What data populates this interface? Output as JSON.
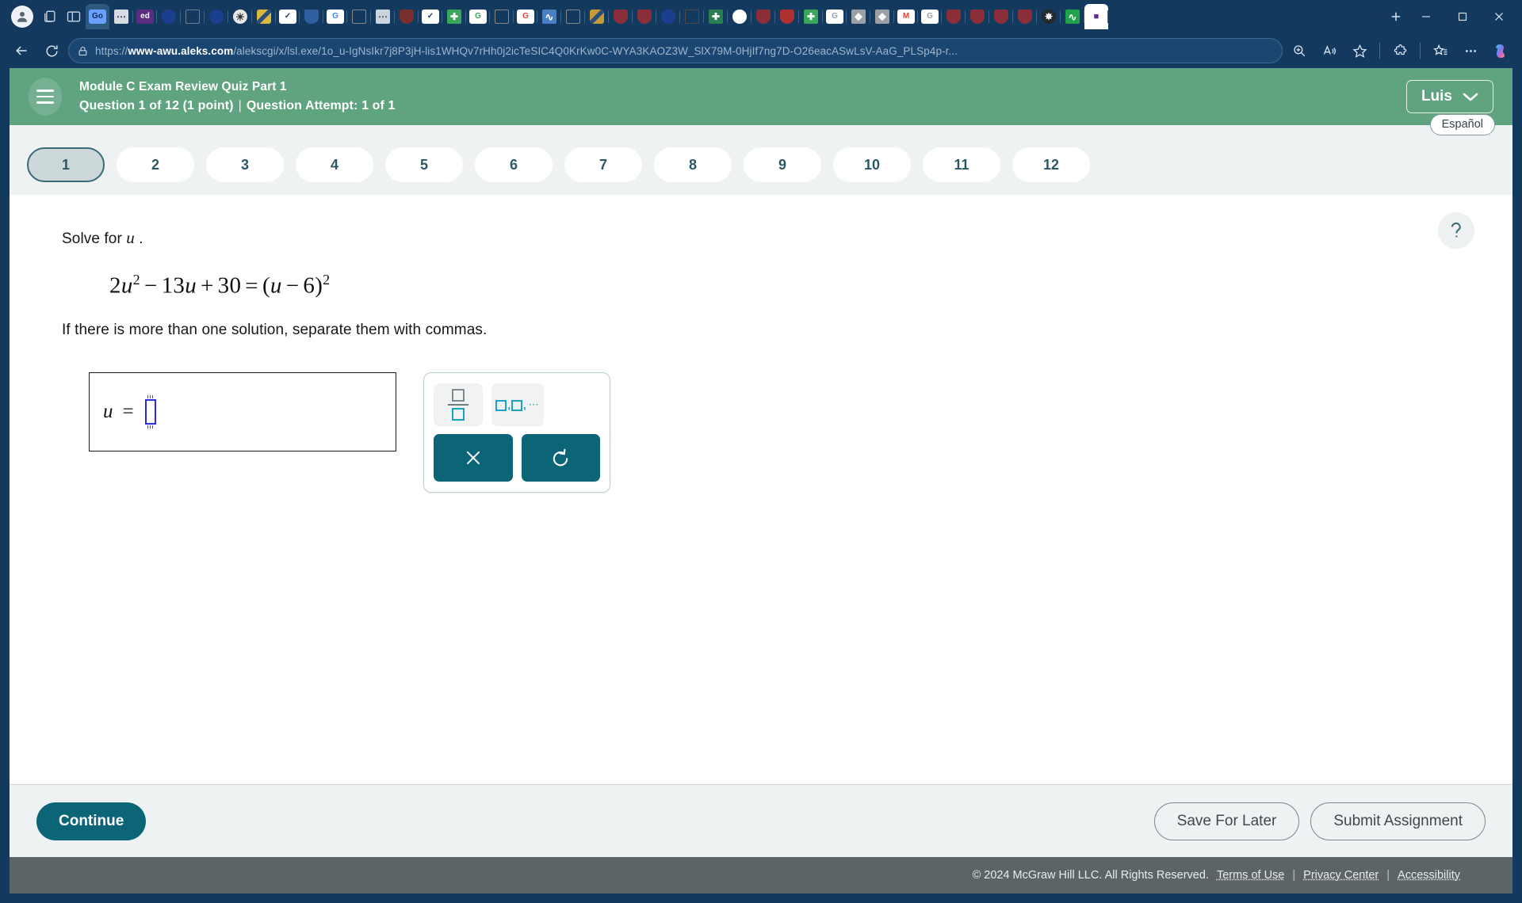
{
  "browser": {
    "url_prefix": "https://",
    "url_domain": "www-awu.aleks.com",
    "url_path": "/alekscgi/x/lsl.exe/1o_u-IgNsIkr7j8P3jH-lis1WHQv7rHh0j2icTeSIC4Q0KrKw0C-WYA3KAOZ3W_SlX79M-0HjIf7ng7D-O26eacASwLsV-AaG_PLSp4p-r...",
    "icons": {
      "profile": "profile-avatar-icon",
      "collections": "collections-icon",
      "split_screen": "split-screen-icon",
      "back": "back-arrow-icon",
      "reload": "reload-icon",
      "lock": "site-lock-icon",
      "zoom": "zoom-icon",
      "read_aloud": "read-aloud-icon",
      "favorite": "favorite-star-icon",
      "extensions": "extensions-puzzle-icon",
      "favorites_bar": "favorites-list-icon",
      "settings_more": "more-options-icon",
      "copilot": "copilot-icon",
      "new_tab": "new-tab-plus-icon",
      "minimize": "minimize-icon",
      "maximize": "maximize-icon",
      "close": "close-window-icon"
    },
    "tabs": [
      {
        "label": "Go",
        "bg": "#6aa0ff",
        "fg": "#0d2b55",
        "kind": "text",
        "state": "active"
      },
      {
        "label": "",
        "bg": "#d8dde3",
        "fg": "#444",
        "kind": "folder",
        "state": "normal"
      },
      {
        "label": "ed",
        "bg": "#5b2d82",
        "fg": "#ffffff",
        "kind": "text",
        "state": "normal"
      },
      {
        "label": "",
        "bg": "#1b3f8f",
        "fg": "#ffffff",
        "kind": "circle",
        "state": "normal"
      },
      {
        "label": "",
        "bg": "#ffffff",
        "fg": "#6b7d8f",
        "kind": "doc",
        "state": "normal"
      },
      {
        "label": "",
        "bg": "#1b3f8f",
        "fg": "#ffffff",
        "kind": "circle",
        "state": "normal"
      },
      {
        "label": "",
        "bg": "#e8e8e8",
        "fg": "#333",
        "kind": "sun",
        "state": "normal"
      },
      {
        "label": "",
        "bg": "#d9b83c",
        "fg": "#2a4d7a",
        "kind": "stripes",
        "state": "normal"
      },
      {
        "label": "✓",
        "bg": "#ffffff",
        "fg": "#1f3a63",
        "kind": "text",
        "state": "normal"
      },
      {
        "label": "",
        "bg": "#2f5f9e",
        "fg": "#ffffff",
        "kind": "crest",
        "state": "normal"
      },
      {
        "label": "G",
        "bg": "#ffffff",
        "fg": "#4285f4",
        "kind": "text",
        "state": "normal"
      },
      {
        "label": "",
        "bg": "#ffffff",
        "fg": "#888",
        "kind": "doc",
        "state": "normal"
      },
      {
        "label": "",
        "bg": "#c9d4de",
        "fg": "#555",
        "kind": "folder",
        "state": "normal"
      },
      {
        "label": "",
        "bg": "#7a2f2f",
        "fg": "#fff",
        "kind": "shield",
        "state": "normal"
      },
      {
        "label": "✓",
        "bg": "#ffffff",
        "fg": "#1f3a63",
        "kind": "text",
        "state": "normal"
      },
      {
        "label": "",
        "bg": "#3aa65a",
        "fg": "#fff",
        "kind": "sheet",
        "state": "normal"
      },
      {
        "label": "G",
        "bg": "#ffffff",
        "fg": "#34a853",
        "kind": "text",
        "state": "normal"
      },
      {
        "label": "",
        "bg": "#ffffff",
        "fg": "#888",
        "kind": "doc",
        "state": "normal"
      },
      {
        "label": "G",
        "bg": "#ffffff",
        "fg": "#ea4335",
        "kind": "text",
        "state": "normal"
      },
      {
        "label": "",
        "bg": "#4a7fc1",
        "fg": "#fff",
        "kind": "wave",
        "state": "normal"
      },
      {
        "label": "",
        "bg": "#ffffff",
        "fg": "#888",
        "kind": "doc",
        "state": "normal"
      },
      {
        "label": "",
        "bg": "#c49a3a",
        "fg": "#fff",
        "kind": "stripes",
        "state": "normal"
      },
      {
        "label": "",
        "bg": "#8a2f3a",
        "fg": "#fff",
        "kind": "shield",
        "state": "normal"
      },
      {
        "label": "",
        "bg": "#8a2f3a",
        "fg": "#fff",
        "kind": "shield",
        "state": "normal"
      },
      {
        "label": "",
        "bg": "#1b3f8f",
        "fg": "#fff",
        "kind": "circle",
        "state": "normal"
      },
      {
        "label": "",
        "bg": "#ffffff",
        "fg": "#4a4a4a",
        "kind": "doc",
        "state": "normal"
      },
      {
        "label": "",
        "bg": "#2a7d4f",
        "fg": "#fff",
        "kind": "sheet",
        "state": "normal"
      },
      {
        "label": "",
        "bg": "#ffffff",
        "fg": "#4285f4",
        "kind": "circle",
        "state": "normal"
      },
      {
        "label": "",
        "bg": "#8a2f3a",
        "fg": "#fff",
        "kind": "shield",
        "state": "normal"
      },
      {
        "label": "",
        "bg": "#b03030",
        "fg": "#fff",
        "kind": "shield",
        "state": "normal"
      },
      {
        "label": "",
        "bg": "#3aa65a",
        "fg": "#fff",
        "kind": "sheet",
        "state": "normal"
      },
      {
        "label": "G",
        "bg": "#ffffff",
        "fg": "#9aa0a6",
        "kind": "text",
        "state": "normal"
      },
      {
        "label": "",
        "bg": "#9aa0a6",
        "fg": "#fff",
        "kind": "unity",
        "state": "normal"
      },
      {
        "label": "",
        "bg": "#9aa0a6",
        "fg": "#fff",
        "kind": "unity",
        "state": "normal"
      },
      {
        "label": "M",
        "bg": "#ffffff",
        "fg": "#ea4335",
        "kind": "text",
        "state": "normal"
      },
      {
        "label": "G",
        "bg": "#ffffff",
        "fg": "#9aa0a6",
        "kind": "text",
        "state": "normal"
      },
      {
        "label": "",
        "bg": "#8a2f3a",
        "fg": "#fff",
        "kind": "shield",
        "state": "normal"
      },
      {
        "label": "",
        "bg": "#8a2f3a",
        "fg": "#fff",
        "kind": "shield",
        "state": "normal"
      },
      {
        "label": "",
        "bg": "#8a2f3a",
        "fg": "#fff",
        "kind": "shield",
        "state": "normal"
      },
      {
        "label": "",
        "bg": "#8a2f3a",
        "fg": "#fff",
        "kind": "shield",
        "state": "normal"
      },
      {
        "label": "",
        "bg": "#23292d",
        "fg": "#fff",
        "kind": "openai",
        "state": "normal"
      },
      {
        "label": "",
        "bg": "#1ea34a",
        "fg": "#fff",
        "kind": "wave",
        "state": "normal"
      },
      {
        "label": "",
        "bg": "#ffffff",
        "fg": "#5b2d82",
        "kind": "chat",
        "state": "selected"
      }
    ]
  },
  "header": {
    "menu_icon": "hamburger-menu-icon",
    "title": "Module C Exam Review Quiz Part 1",
    "question_status": "Question 1 of 12 (1 point)",
    "divider": "|",
    "attempt_status": "Question Attempt: 1 of 1",
    "user_name": "Luis",
    "user_chevron": "chevron-down-icon",
    "bg_color": "#5fa37f"
  },
  "language": {
    "label": "Español"
  },
  "question_nav": {
    "items": [
      {
        "label": "1",
        "active": true
      },
      {
        "label": "2",
        "active": false
      },
      {
        "label": "3",
        "active": false
      },
      {
        "label": "4",
        "active": false
      },
      {
        "label": "5",
        "active": false
      },
      {
        "label": "6",
        "active": false
      },
      {
        "label": "7",
        "active": false
      },
      {
        "label": "8",
        "active": false
      },
      {
        "label": "9",
        "active": false
      },
      {
        "label": "10",
        "active": false
      },
      {
        "label": "11",
        "active": false
      },
      {
        "label": "12",
        "active": false
      }
    ]
  },
  "question": {
    "help_icon": "question-mark-help-icon",
    "prompt_prefix": "Solve for",
    "prompt_variable": "u",
    "prompt_suffix": ".",
    "equation": {
      "lhs_coef": "2",
      "lhs_var": "u",
      "lhs_exp": "2",
      "minus": "−",
      "term2_coef": "13",
      "term2_var": "u",
      "plus": "+",
      "term3": "30",
      "equals": "=",
      "rhs_open": "(",
      "rhs_var": "u",
      "rhs_minus": "−",
      "rhs_num": "6",
      "rhs_close": ")",
      "rhs_exp": "2",
      "plain": "2u^2 - 13u + 30 = (u - 6)^2"
    },
    "sub_prompt": "If there is more than one solution, separate them with commas.",
    "answer": {
      "variable": "u",
      "equals": "=",
      "value": ""
    }
  },
  "math_palette": {
    "keys": [
      {
        "name": "fraction-button",
        "type": "fraction",
        "aria": "Fraction"
      },
      {
        "name": "list-button",
        "type": "list",
        "aria": "Comma separated list"
      }
    ],
    "actions": [
      {
        "name": "clear-button",
        "glyph": "✕",
        "aria": "Clear"
      },
      {
        "name": "undo-button",
        "glyph": "↺",
        "aria": "Undo"
      }
    ],
    "accent_color": "#0b6576",
    "icon_color": "#18a2c4"
  },
  "actions": {
    "continue_label": "Continue",
    "save_label": "Save For Later",
    "submit_label": "Submit Assignment"
  },
  "footer": {
    "copyright": "© 2024 McGraw Hill LLC. All Rights Reserved.",
    "links": [
      "Terms of Use",
      "Privacy Center",
      "Accessibility"
    ],
    "separator": "|"
  }
}
